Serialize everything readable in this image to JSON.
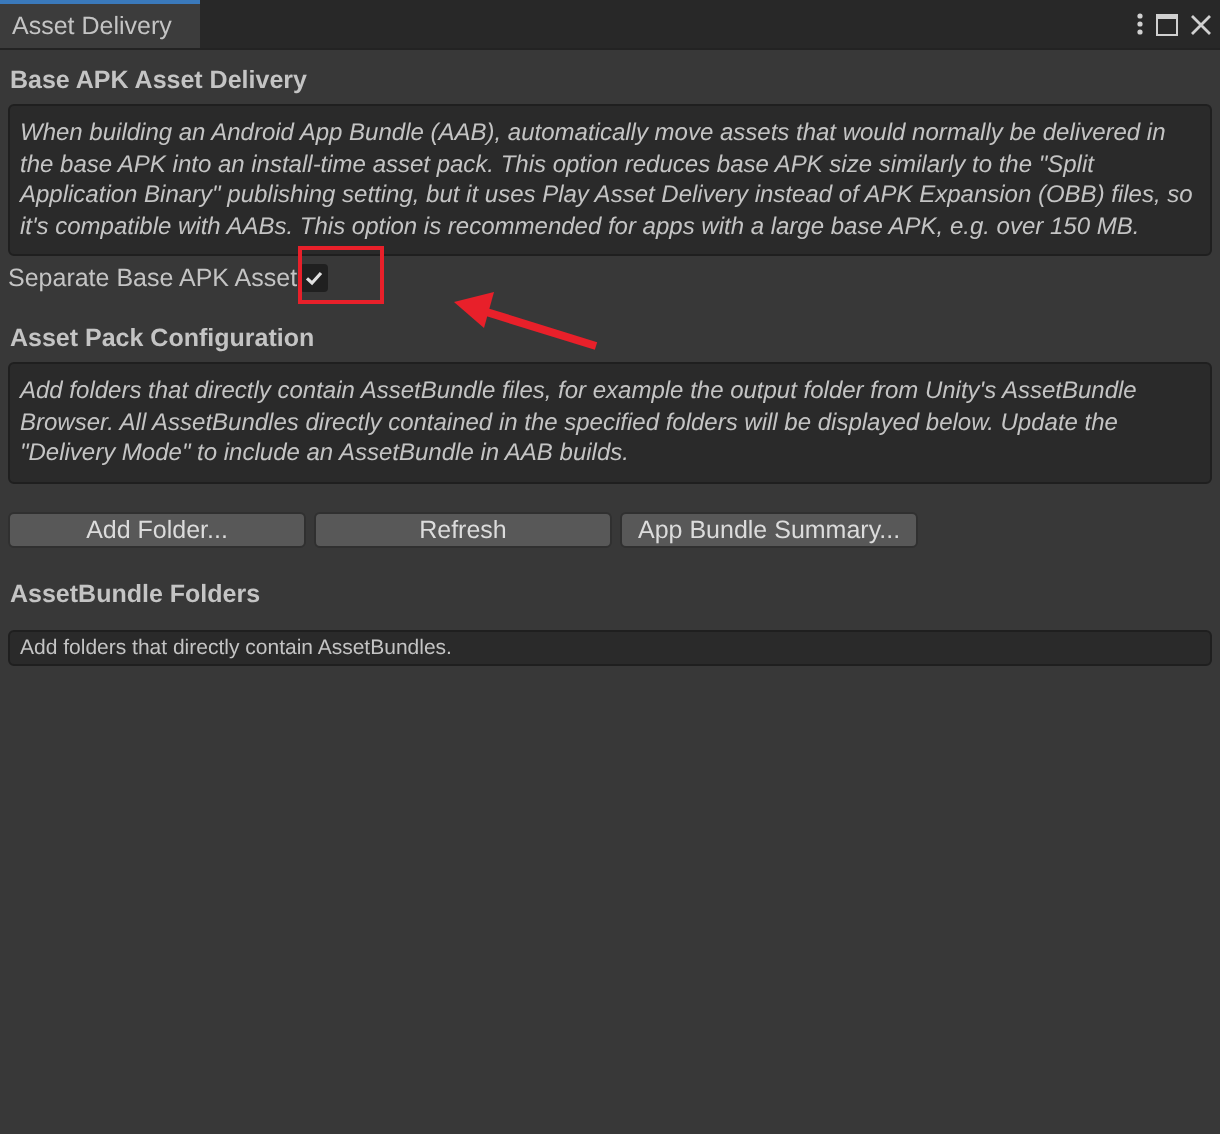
{
  "tab": {
    "title": "Asset Delivery",
    "selected": true
  },
  "sections": [
    {
      "kind": "heading",
      "text": "Base APK Asset Delivery"
    },
    {
      "kind": "help",
      "text": "When building an Android App Bundle (AAB), automatically move assets that would normally be delivered in the base APK into an install-time asset pack. This option reduces base APK size similarly to the \"Split Application Binary\" publishing setting, but it uses Play Asset Delivery instead of APK Expansion (OBB) files, so it's compatible with AABs. This option is recommended for apps with a large base APK, e.g. over 150 MB."
    },
    {
      "kind": "toggle",
      "text": "Separate Base APK Asset",
      "checked": true
    },
    {
      "kind": "heading",
      "text": "Asset Pack Configuration"
    },
    {
      "kind": "help",
      "text": "Add folders that directly contain AssetBundle files, for example the output folder from Unity's AssetBundle Browser. All AssetBundles directly contained in the specified folders will be displayed below. Update the \"Delivery Mode\" to include an AssetBundle in AAB builds."
    },
    {
      "kind": "buttons",
      "items": [
        "Add Folder...",
        "Refresh",
        "App Bundle Summary..."
      ]
    },
    {
      "kind": "heading",
      "text": "AssetBundle Folders"
    },
    {
      "kind": "note",
      "text": "Add folders that directly contain AssetBundles."
    }
  ]
}
